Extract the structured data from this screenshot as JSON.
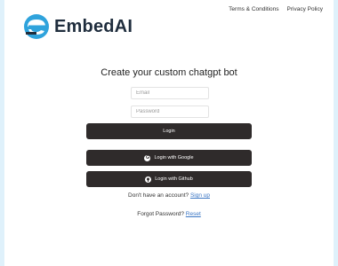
{
  "header": {
    "terms_link": "Terms & Conditions",
    "privacy_link": "Privacy Policy"
  },
  "brand": {
    "name": "EmbedAI",
    "accent_color": "#2fa3dc",
    "dark_color": "#1f2d3d"
  },
  "main": {
    "heading": "Create your custom chatgpt bot",
    "email_placeholder": "Email",
    "password_placeholder": "Password",
    "login_button": "Login",
    "google_button": "Login with Google",
    "github_button": "Login with Github",
    "no_account_text": "Don't have an account?",
    "signup_link": "Sign up",
    "forgot_text": "Forgot Password?",
    "reset_link": "Reset"
  },
  "icons": {
    "google": "google-icon",
    "github": "github-icon"
  }
}
